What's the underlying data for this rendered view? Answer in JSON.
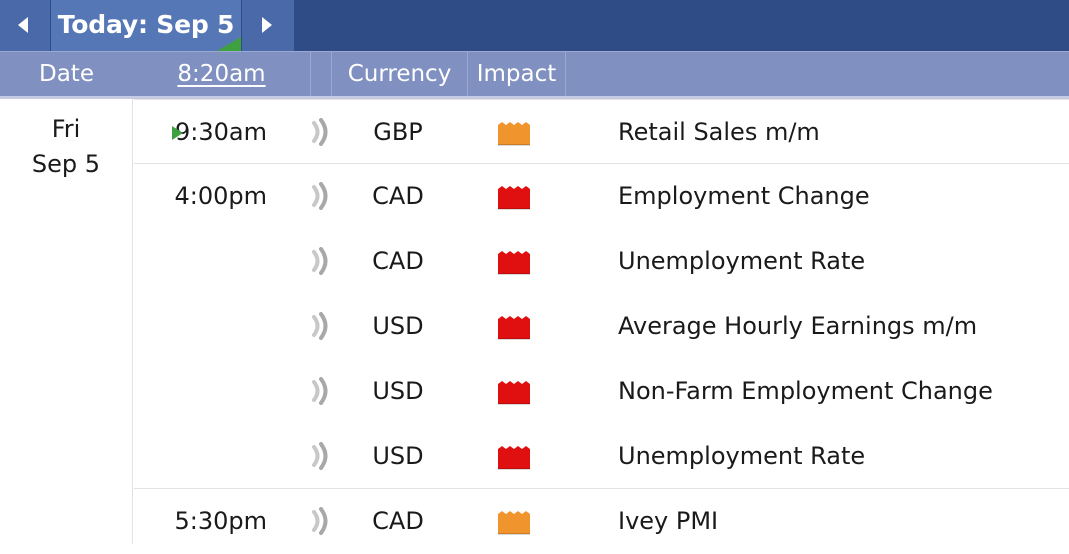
{
  "nav": {
    "today_label": "Today: Sep 5",
    "prev_icon": "caret-left-icon",
    "next_icon": "caret-right-icon"
  },
  "columns": {
    "date": "Date",
    "time": "8:20am",
    "currency": "Currency",
    "impact": "Impact"
  },
  "day": {
    "weekday": "Fri",
    "date": "Sep 5"
  },
  "impact_colors": {
    "medium": "#f0952e",
    "high": "#e01010"
  },
  "events": [
    {
      "time": "9:30am",
      "currency": "GBP",
      "impact": "medium",
      "title": "Retail Sales m/m",
      "upcoming": true
    },
    {
      "time": "4:00pm",
      "currency": "CAD",
      "impact": "high",
      "title": "Employment Change"
    },
    {
      "time": "",
      "currency": "CAD",
      "impact": "high",
      "title": "Unemployment Rate"
    },
    {
      "time": "",
      "currency": "USD",
      "impact": "high",
      "title": "Average Hourly Earnings m/m"
    },
    {
      "time": "",
      "currency": "USD",
      "impact": "high",
      "title": "Non-Farm Employment Change"
    },
    {
      "time": "",
      "currency": "USD",
      "impact": "high",
      "title": "Unemployment Rate"
    },
    {
      "time": "5:30pm",
      "currency": "CAD",
      "impact": "medium",
      "title": "Ivey PMI"
    }
  ]
}
